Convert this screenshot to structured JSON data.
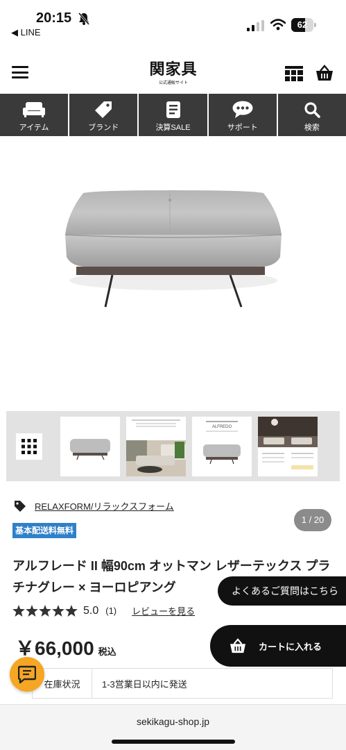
{
  "status_bar": {
    "time": "20:15",
    "back_app": "◀ LINE",
    "battery": "62",
    "battery_level": 0.62
  },
  "header": {
    "logo": "関家具",
    "logo_sub": "公式通販サイト"
  },
  "nav": {
    "items": [
      {
        "label": "アイテム",
        "icon": "sofa-icon"
      },
      {
        "label": "ブランド",
        "icon": "tag-icon"
      },
      {
        "label": "決算SALE",
        "icon": "document-icon"
      },
      {
        "label": "サポート",
        "icon": "chat-bubble-icon"
      },
      {
        "label": "検索",
        "icon": "search-icon"
      }
    ]
  },
  "gallery": {
    "counter": "1 / 20",
    "current_index": 1,
    "total": 20
  },
  "product": {
    "brand": "RELAXFORM/リラックスフォーム",
    "badge": "基本配送料無料",
    "title": "アルフレード II 幅90cm オットマン レザーテックス プラチナグレー × ヨーロピアング",
    "rating_value": "5.0",
    "rating_count": "(1)",
    "stars": 5,
    "review_link": "レビューを見る",
    "price": "￥66,000",
    "tax_label": "税込",
    "stock_label": "在庫状況",
    "stock_value": "1-3営業日以内に発送"
  },
  "floating": {
    "faq": "よくあるご質問はこちら",
    "cart": "カートに入れる"
  },
  "browser": {
    "url": "sekikagu-shop.jp"
  },
  "colors": {
    "nav_bg": "#3a3a3a",
    "badge_blue": "#2f80c8",
    "chat_orange": "#f5a623"
  }
}
